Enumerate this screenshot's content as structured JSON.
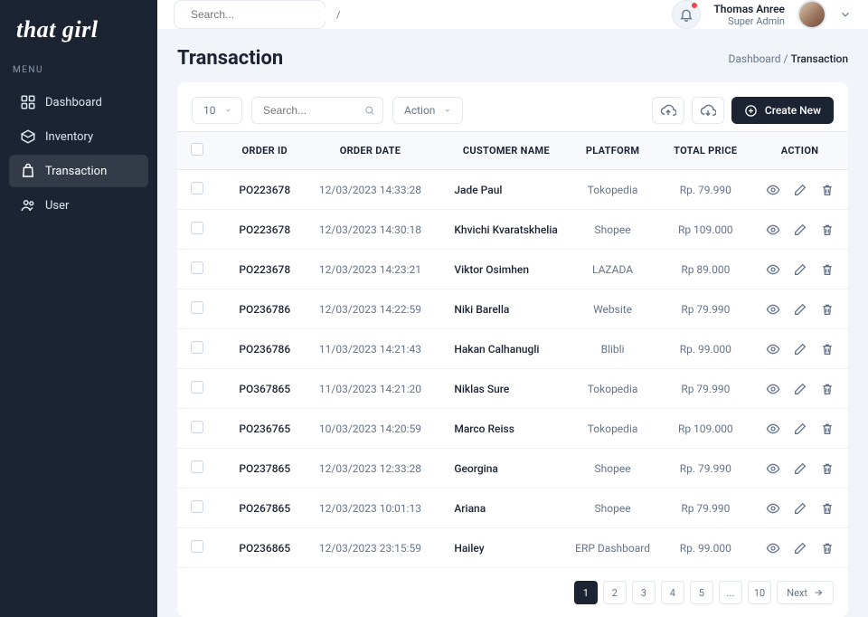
{
  "brand": "that girl",
  "menu_label": "MENU",
  "sidebar": {
    "items": [
      {
        "label": "Dashboard"
      },
      {
        "label": "Inventory"
      },
      {
        "label": "Transaction"
      },
      {
        "label": "User"
      }
    ]
  },
  "header": {
    "search_placeholder": "Search...",
    "kbd": "/",
    "user_name": "Thomas Anree",
    "user_role": "Super Admin"
  },
  "page": {
    "title": "Transaction",
    "breadcrumb_root": "Dashboard",
    "breadcrumb_sep": "/",
    "breadcrumb_current": "Transaction"
  },
  "toolbar": {
    "pagesize": "10",
    "search_placeholder": "Search...",
    "action_label": "Action",
    "create_label": "Create New"
  },
  "table": {
    "headers": {
      "order_id": "ORDER ID",
      "order_date": "ORDER DATE",
      "customer": "CUSTOMER NAME",
      "platform": "PLATFORM",
      "total": "TOTAL PRICE",
      "action": "ACTION"
    },
    "rows": [
      {
        "order_id": "PO223678",
        "date": "12/03/2023 14:33:28",
        "customer": "Jade Paul",
        "platform": "Tokopedia",
        "total": "Rp. 79.990"
      },
      {
        "order_id": "PO223678",
        "date": "12/03/2023 14:30:18",
        "customer": "Khvichi Kvaratskhelia",
        "platform": "Shopee",
        "total": "Rp 109.000"
      },
      {
        "order_id": "PO223678",
        "date": "12/03/2023 14:23:21",
        "customer": "Viktor Osimhen",
        "platform": "LAZADA",
        "total": "Rp 89.000"
      },
      {
        "order_id": "PO236786",
        "date": "12/03/2023 14:22:59",
        "customer": "Niki Barella",
        "platform": "Website",
        "total": "Rp 79.990"
      },
      {
        "order_id": "PO236786",
        "date": "11/03/2023 14:21:43",
        "customer": "Hakan Calhanugli",
        "platform": "Blibli",
        "total": "Rp. 99.000"
      },
      {
        "order_id": "PO367865",
        "date": "11/03/2023 14:21:20",
        "customer": "Niklas Sure",
        "platform": "Tokopedia",
        "total": "Rp 79.990"
      },
      {
        "order_id": "PO236765",
        "date": "10/03/2023 14:20:59",
        "customer": "Marco Reiss",
        "platform": "Tokopedia",
        "total": "Rp 109.000"
      },
      {
        "order_id": "PO237865",
        "date": "12/03/2023 12:33:28",
        "customer": "Georgina",
        "platform": "Shopee",
        "total": "Rp. 79.990"
      },
      {
        "order_id": "PO267865",
        "date": "12/03/2023 10:01:13",
        "customer": "Ariana",
        "platform": "Shopee",
        "total": "Rp 79.990"
      },
      {
        "order_id": "PO236865",
        "date": "12/03/2023 23:15:59",
        "customer": "Hailey",
        "platform": "ERP Dashboard",
        "total": "Rp. 99.000"
      }
    ]
  },
  "pagination": {
    "pages": [
      "1",
      "2",
      "3",
      "4",
      "5",
      "...",
      "10"
    ],
    "next": "Next"
  }
}
